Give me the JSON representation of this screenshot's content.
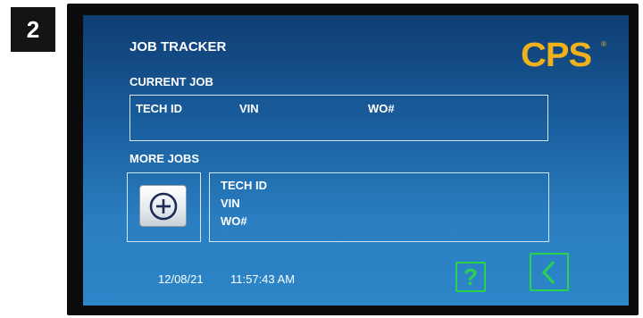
{
  "step_badge": "2",
  "header": {
    "title": "JOB TRACKER",
    "logo_text": "CPS",
    "logo_reg": "®"
  },
  "current_job": {
    "label": "CURRENT JOB",
    "columns": [
      "TECH ID",
      "VIN",
      "WO#"
    ]
  },
  "more_jobs": {
    "label": "MORE JOBS",
    "fields": [
      "TECH ID",
      "VIN",
      "WO#"
    ]
  },
  "footer": {
    "date": "12/08/21",
    "time": "11:57:43 AM",
    "help_label": "?"
  },
  "icons": {
    "add": "plus-circle-icon",
    "back": "chevron-left-icon"
  },
  "colors": {
    "accent_green": "#2bd24c",
    "logo_yellow": "#f0b21b",
    "screen_top": "#0f3d72",
    "screen_bottom": "#2c86c8"
  }
}
